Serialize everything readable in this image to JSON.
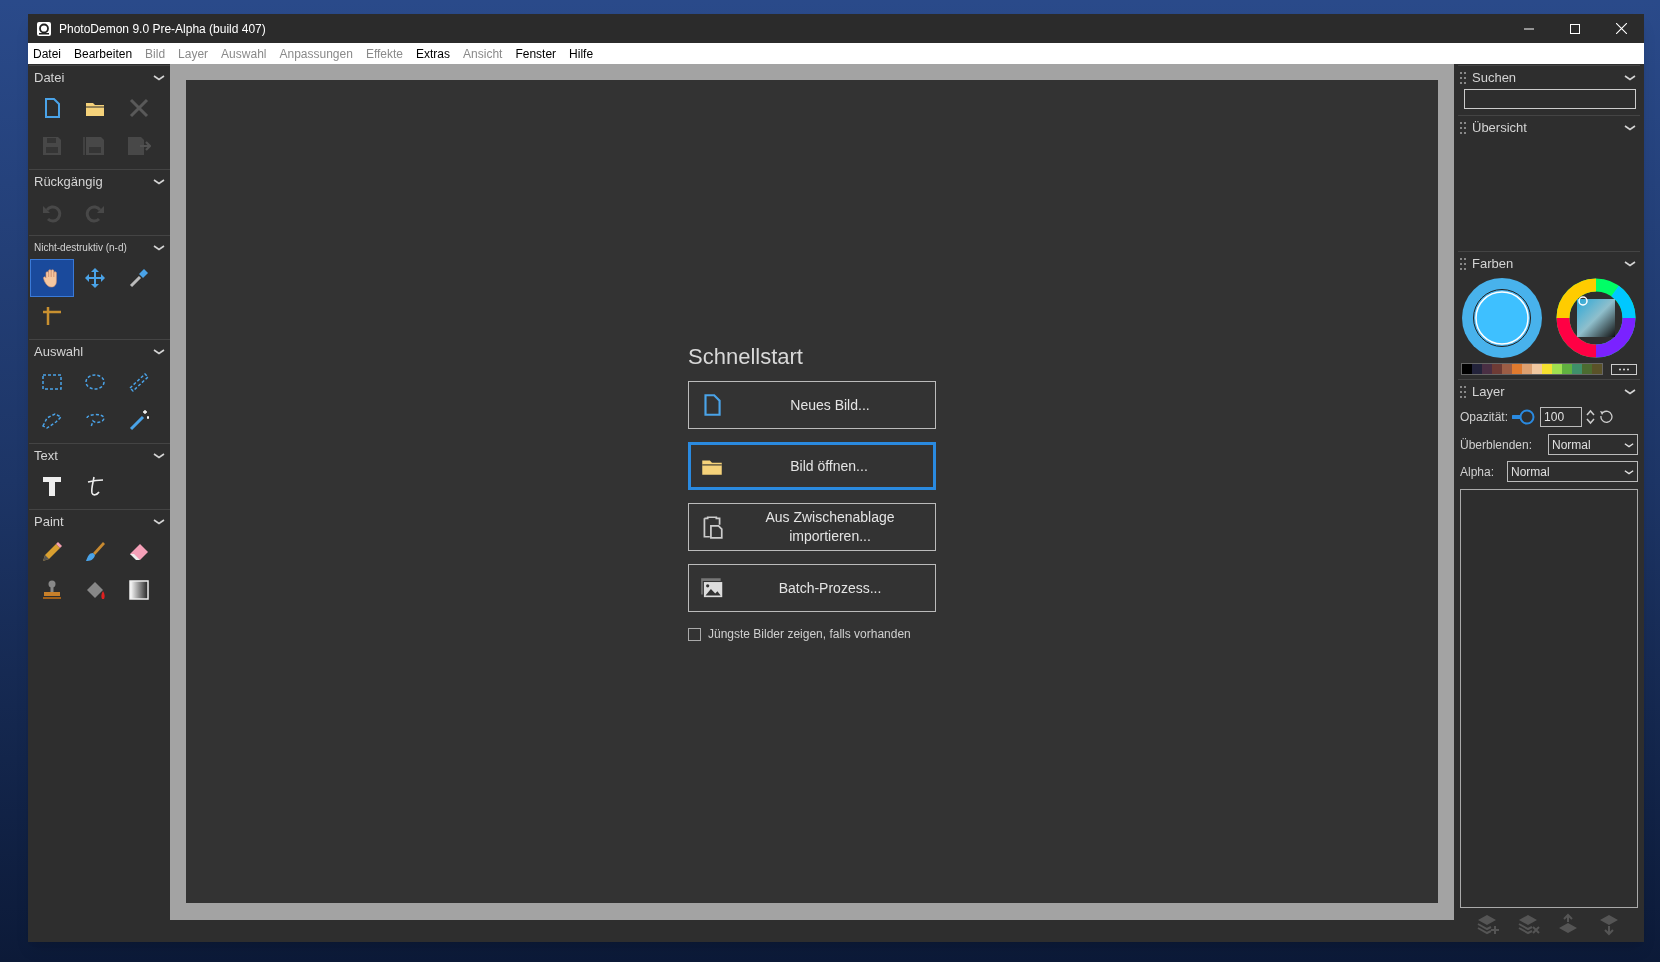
{
  "window": {
    "title": "PhotoDemon 9.0 Pre-Alpha (build 407)"
  },
  "menu": [
    {
      "label": "Datei",
      "disabled": false
    },
    {
      "label": "Bearbeiten",
      "disabled": false
    },
    {
      "label": "Bild",
      "disabled": true
    },
    {
      "label": "Layer",
      "disabled": true
    },
    {
      "label": "Auswahl",
      "disabled": true
    },
    {
      "label": "Anpassungen",
      "disabled": true
    },
    {
      "label": "Effekte",
      "disabled": true
    },
    {
      "label": "Extras",
      "disabled": false
    },
    {
      "label": "Ansicht",
      "disabled": true
    },
    {
      "label": "Fenster",
      "disabled": false
    },
    {
      "label": "Hilfe",
      "disabled": false
    }
  ],
  "toolbox": [
    {
      "title": "Datei",
      "small": false,
      "tools": [
        {
          "kind": "new",
          "selected": false,
          "disabled": false
        },
        {
          "kind": "open",
          "selected": false,
          "disabled": false
        },
        {
          "kind": "close",
          "selected": false,
          "disabled": true
        },
        {
          "kind": "save",
          "selected": false,
          "disabled": true
        },
        {
          "kind": "saveas",
          "selected": false,
          "disabled": true
        },
        {
          "kind": "export",
          "selected": false,
          "disabled": true
        }
      ]
    },
    {
      "title": "Rückgängig",
      "small": false,
      "tools": [
        {
          "kind": "undo",
          "selected": false,
          "disabled": true
        },
        {
          "kind": "redo",
          "selected": false,
          "disabled": true
        }
      ]
    },
    {
      "title": "Nicht-destruktiv (n-d)",
      "small": true,
      "tools": [
        {
          "kind": "hand",
          "selected": true,
          "disabled": false
        },
        {
          "kind": "move",
          "selected": false,
          "disabled": false
        },
        {
          "kind": "dropper",
          "selected": false,
          "disabled": false
        },
        {
          "kind": "crop",
          "selected": false,
          "disabled": false
        }
      ]
    },
    {
      "title": "Auswahl",
      "small": false,
      "tools": [
        {
          "kind": "rect",
          "selected": false,
          "disabled": false
        },
        {
          "kind": "ellipse",
          "selected": false,
          "disabled": false
        },
        {
          "kind": "line",
          "selected": false,
          "disabled": false
        },
        {
          "kind": "polygon",
          "selected": false,
          "disabled": false
        },
        {
          "kind": "lasso",
          "selected": false,
          "disabled": false
        },
        {
          "kind": "wand",
          "selected": false,
          "disabled": false
        }
      ]
    },
    {
      "title": "Text",
      "small": false,
      "tools": [
        {
          "kind": "text",
          "selected": false,
          "disabled": false
        },
        {
          "kind": "fancytext",
          "selected": false,
          "disabled": false
        }
      ]
    },
    {
      "title": "Paint",
      "small": false,
      "tools": [
        {
          "kind": "pencil",
          "selected": false,
          "disabled": false
        },
        {
          "kind": "brush",
          "selected": false,
          "disabled": false
        },
        {
          "kind": "eraser",
          "selected": false,
          "disabled": false
        },
        {
          "kind": "stamp",
          "selected": false,
          "disabled": false
        },
        {
          "kind": "fill",
          "selected": false,
          "disabled": false
        },
        {
          "kind": "gradient",
          "selected": false,
          "disabled": false
        }
      ]
    }
  ],
  "quickstart": {
    "title": "Schnellstart",
    "buttons": [
      {
        "kind": "new",
        "label": "Neues Bild...",
        "focused": false
      },
      {
        "kind": "open",
        "label": "Bild öffnen...",
        "focused": true
      },
      {
        "kind": "clipboard",
        "label": "Aus Zwischenablage importieren...",
        "focused": false
      },
      {
        "kind": "batch",
        "label": "Batch-Prozess...",
        "focused": false
      }
    ],
    "checkbox": {
      "label": "Jüngste Bilder zeigen, falls vorhanden",
      "checked": false
    }
  },
  "right_panel": {
    "search": {
      "title": "Suchen"
    },
    "overview": {
      "title": "Übersicht"
    },
    "colors": {
      "title": "Farben",
      "palette": [
        {
          "color": "#000000"
        },
        {
          "color": "#23233b"
        },
        {
          "color": "#4a2f44"
        },
        {
          "color": "#6e3b35"
        },
        {
          "color": "#9c5d45"
        },
        {
          "color": "#e07a2e"
        },
        {
          "color": "#dda070"
        },
        {
          "color": "#f0c8a0"
        },
        {
          "color": "#f5e030"
        },
        {
          "color": "#a0e050"
        },
        {
          "color": "#60b040"
        },
        {
          "color": "#3f8f6a"
        },
        {
          "color": "#4c6b30"
        },
        {
          "color": "#5a5228"
        }
      ]
    },
    "layer": {
      "title": "Layer",
      "opacity_label": "Opazität:",
      "opacity_value": "100",
      "blend_label": "Überblenden:",
      "blend_value": "Normal",
      "alpha_label": "Alpha:",
      "alpha_value": "Normal"
    }
  }
}
